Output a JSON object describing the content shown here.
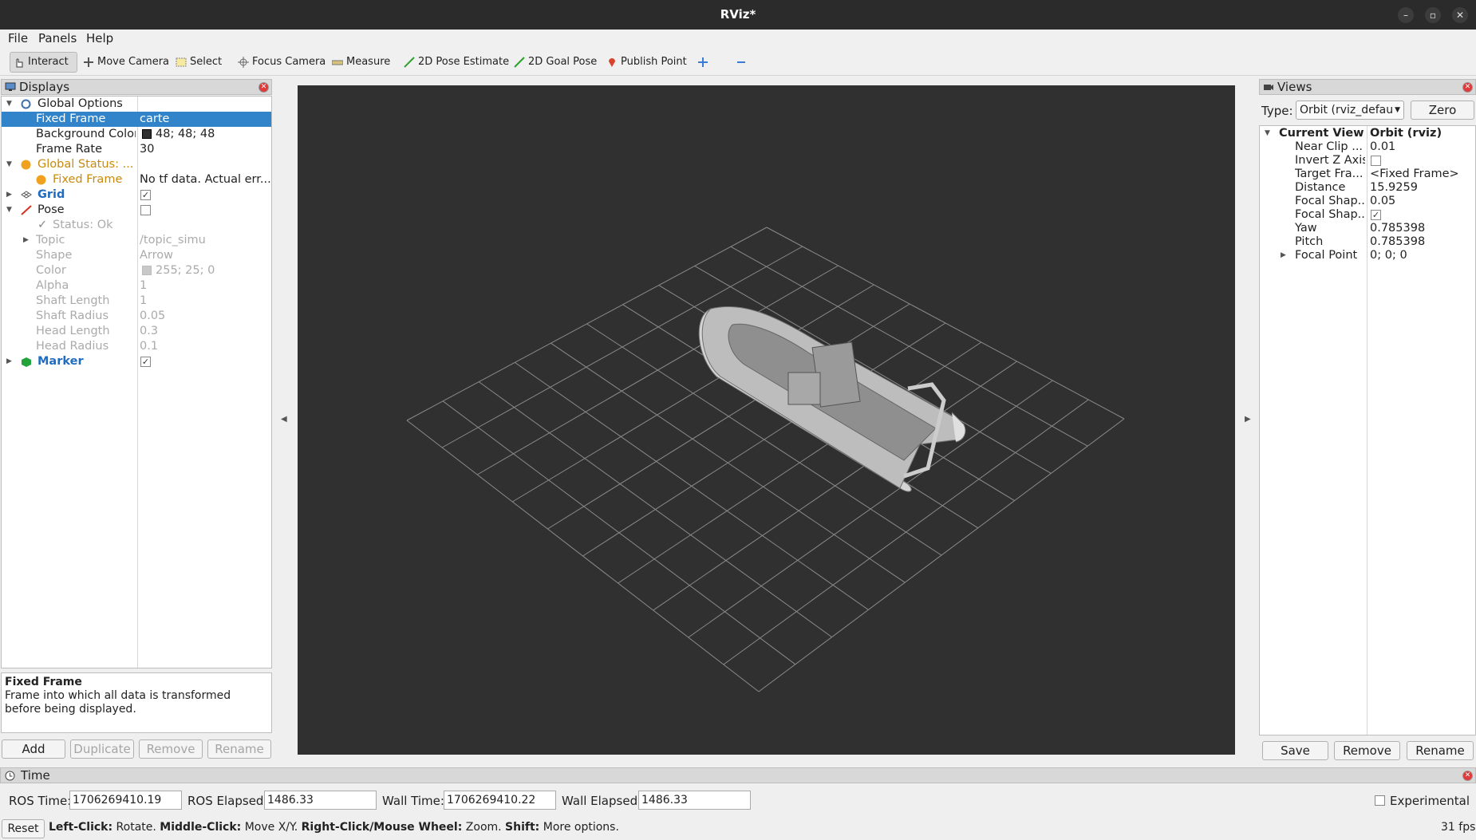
{
  "window": {
    "title": "RViz*"
  },
  "menu": [
    "File",
    "Panels",
    "Help"
  ],
  "toolbar": {
    "interact": "Interact",
    "move_camera": "Move Camera",
    "select": "Select",
    "focus_camera": "Focus Camera",
    "measure": "Measure",
    "pose_estimate": "2D Pose Estimate",
    "goal_pose": "2D Goal Pose",
    "publish_point": "Publish Point"
  },
  "displays": {
    "title": "Displays",
    "rows": [
      {
        "key": "Global Options",
        "value": ""
      },
      {
        "key": "Fixed Frame",
        "value": "carte"
      },
      {
        "key": "Background Color",
        "value": "48; 48; 48"
      },
      {
        "key": "Frame Rate",
        "value": "30"
      },
      {
        "key": "Global Status: ...",
        "value": ""
      },
      {
        "key": "Fixed Frame",
        "value": "No tf data.  Actual err..."
      },
      {
        "key": "Grid",
        "value": ""
      },
      {
        "key": "Pose",
        "value": ""
      },
      {
        "key": "Status: Ok",
        "value": ""
      },
      {
        "key": "Topic",
        "value": "/topic_simu"
      },
      {
        "key": "Shape",
        "value": "Arrow"
      },
      {
        "key": "Color",
        "value": "255; 25; 0"
      },
      {
        "key": "Alpha",
        "value": "1"
      },
      {
        "key": "Shaft Length",
        "value": "1"
      },
      {
        "key": "Shaft Radius",
        "value": "0.05"
      },
      {
        "key": "Head Length",
        "value": "0.3"
      },
      {
        "key": "Head Radius",
        "value": "0.1"
      },
      {
        "key": "Marker",
        "value": ""
      }
    ],
    "description_title": "Fixed Frame",
    "description_text": "Frame into which all data is transformed before being displayed.",
    "buttons": {
      "add": "Add",
      "duplicate": "Duplicate",
      "remove": "Remove",
      "rename": "Rename"
    }
  },
  "views": {
    "title": "Views",
    "type_label": "Type:",
    "type_value": "Orbit (rviz_defau",
    "zero": "Zero",
    "rows": [
      {
        "key": "Current View",
        "value": "Orbit (rviz)"
      },
      {
        "key": "Near Clip ...",
        "value": "0.01"
      },
      {
        "key": "Invert Z Axis",
        "value": ""
      },
      {
        "key": "Target Fra...",
        "value": "<Fixed Frame>"
      },
      {
        "key": "Distance",
        "value": "15.9259"
      },
      {
        "key": "Focal Shap...",
        "value": "0.05"
      },
      {
        "key": "Focal Shap...",
        "value": ""
      },
      {
        "key": "Yaw",
        "value": "0.785398"
      },
      {
        "key": "Pitch",
        "value": "0.785398"
      },
      {
        "key": "Focal Point",
        "value": "0; 0; 0"
      }
    ],
    "buttons": {
      "save": "Save",
      "remove": "Remove",
      "rename": "Rename"
    }
  },
  "time": {
    "title": "Time",
    "ros_time_label": "ROS Time:",
    "ros_time": "1706269410.19",
    "ros_elapsed_label": "ROS Elapsed:",
    "ros_elapsed": "1486.33",
    "wall_time_label": "Wall Time:",
    "wall_time": "1706269410.22",
    "wall_elapsed_label": "Wall Elapsed:",
    "wall_elapsed": "1486.33",
    "experimental": "Experimental"
  },
  "status": {
    "reset": "Reset",
    "left_click": "Left-Click:",
    "left_click_desc": "Rotate.",
    "middle_click": "Middle-Click:",
    "middle_click_desc": "Move X/Y.",
    "right_click": "Right-Click/Mouse Wheel:",
    "right_click_desc": "Zoom.",
    "shift": "Shift:",
    "shift_desc": "More options.",
    "fps": "31 fps"
  },
  "colors": {
    "viewport_bg": "#303030",
    "selection": "#3184c9",
    "warning": "#c88a0b",
    "link": "#1f6cc0"
  }
}
